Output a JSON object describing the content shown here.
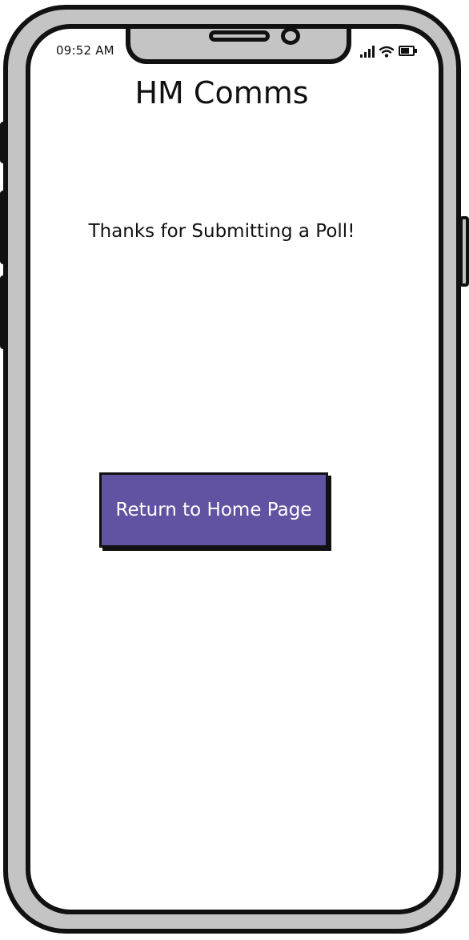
{
  "status_bar": {
    "time": "09:52 AM",
    "icons": [
      "signal-icon",
      "wifi-icon",
      "battery-icon"
    ]
  },
  "app": {
    "title": "HM Comms"
  },
  "main": {
    "message": "Thanks for Submitting a Poll!",
    "home_button_label": "Return to Home Page"
  },
  "colors": {
    "button_background": "#6153a1",
    "button_text": "#ffffff",
    "frame": "#c4c4c4",
    "outline": "#111111"
  }
}
